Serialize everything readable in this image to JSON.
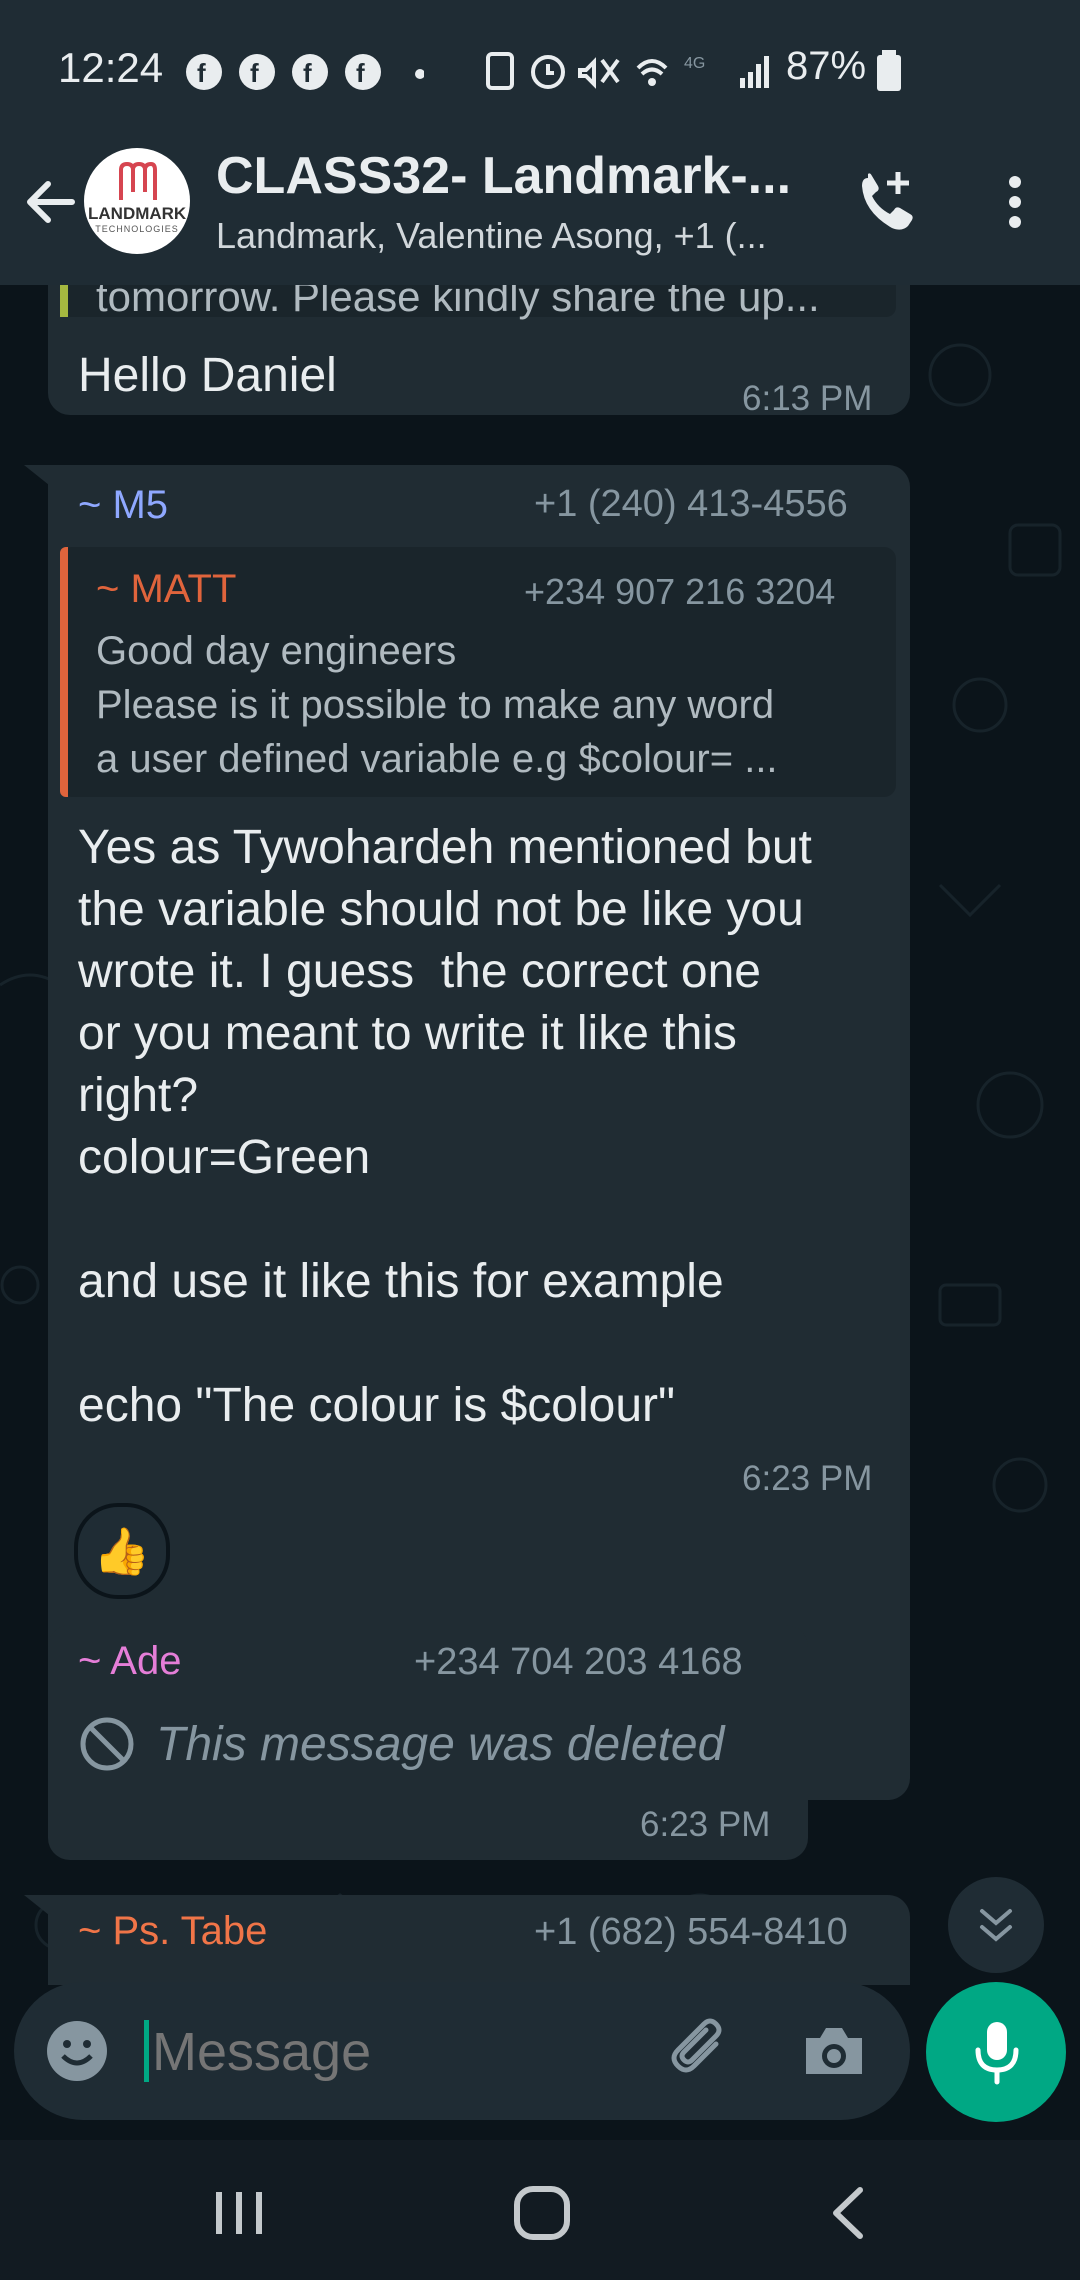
{
  "status_bar": {
    "time": "12:24",
    "battery": "87%",
    "network": "4G"
  },
  "header": {
    "title": "CLASS32- Landmark-...",
    "subtitle": "Landmark, Valentine Asong, +1 (...",
    "avatar_line1": "LANDMARK",
    "avatar_line2": "TECHNOLOGIES"
  },
  "messages": {
    "m1": {
      "quote_text": "tomorrow. Please kindly share the up...",
      "text": "Hello Daniel",
      "time": "6:13 PM"
    },
    "m2": {
      "sender": "~ M5",
      "phone": "+1 (240) 413-4556",
      "quote_sender": "~ MATT",
      "quote_phone": "+234 907 216 3204",
      "quote_line1": "Good day engineers",
      "quote_line2": "Please is it possible to make any word",
      "quote_line3": "a user defined variable e.g $colour= ...",
      "text": "Yes as Tywohardeh mentioned but\nthe variable should not be like you\nwrote it. I guess  the correct one\nor you meant to write it like this\nright?\ncolour=Green\n\nand use it like this for example\n\necho \"The colour is $colour\"",
      "time": "6:23 PM",
      "reaction": "👍"
    },
    "m3": {
      "sender": "~ Ade",
      "phone": "+234 704 203 4168",
      "text": "This message was deleted",
      "time": "6:23 PM"
    },
    "m4": {
      "sender": "~ Ps. Tabe",
      "phone": "+1 (682) 554-8410"
    }
  },
  "input": {
    "placeholder": "Message"
  },
  "colors": {
    "background": "#0b141a",
    "bubble": "#202c33",
    "header": "#1f2c34",
    "accent": "#00a884",
    "sender_m5": "#8fa8ff",
    "sender_matt": "#e0643c",
    "sender_ade": "#e57ed8",
    "sender_tabe": "#f07548"
  },
  "icons": [
    "back-arrow-icon",
    "add-call-icon",
    "more-options-icon",
    "scroll-down-icon",
    "emoji-icon",
    "attach-icon",
    "camera-icon",
    "mic-icon",
    "blocked-icon",
    "recent-apps-icon",
    "home-icon",
    "nav-back-icon"
  ]
}
